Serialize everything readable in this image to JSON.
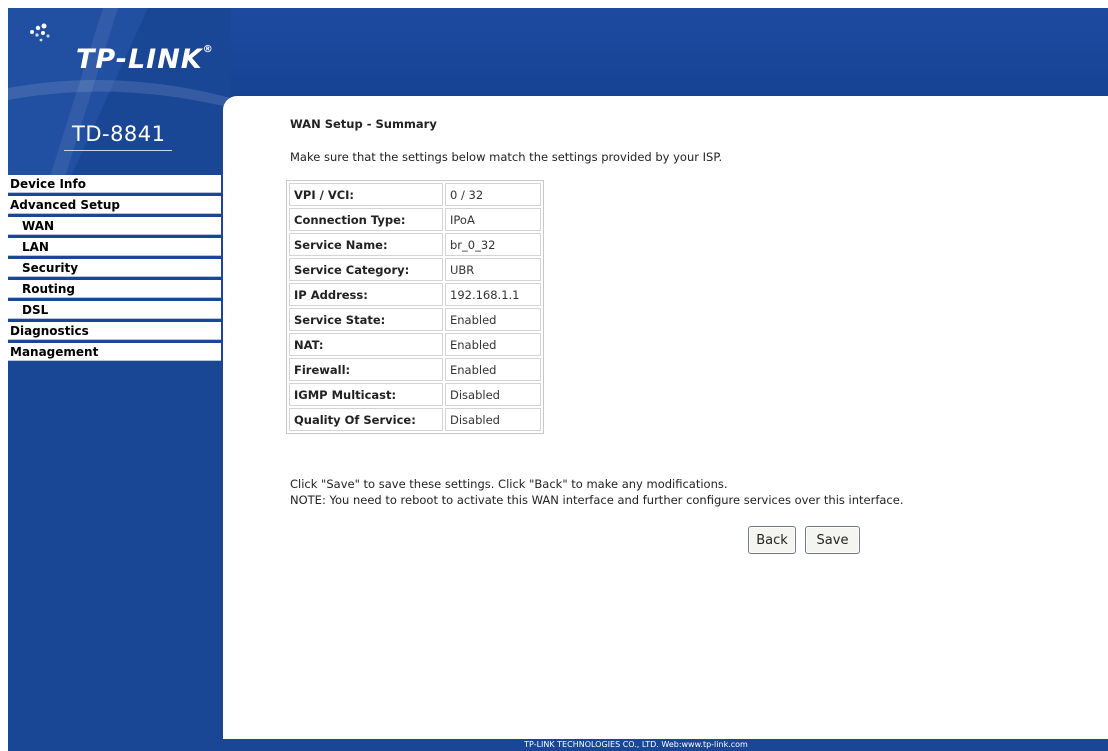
{
  "brand": {
    "logo_text": "TP-LINK",
    "trademark": "®",
    "model": "TD-8841"
  },
  "menu": [
    {
      "label": "Device Info",
      "level": 0
    },
    {
      "label": "Advanced Setup",
      "level": 0
    },
    {
      "label": "WAN",
      "level": 1
    },
    {
      "label": "LAN",
      "level": 1
    },
    {
      "label": "Security",
      "level": 1
    },
    {
      "label": "Routing",
      "level": 1
    },
    {
      "label": "DSL",
      "level": 1
    },
    {
      "label": "Diagnostics",
      "level": 0
    },
    {
      "label": "Management",
      "level": 0
    }
  ],
  "page": {
    "title": "WAN Setup - Summary",
    "intro": "Make sure that the settings below match the settings provided by your ISP.",
    "note1": "Click \"Save\" to save these settings. Click \"Back\" to make any modifications.",
    "note2": "NOTE: You need to reboot to activate this WAN interface and further configure services over this interface."
  },
  "summary": [
    {
      "key": "VPI / VCI:",
      "value": "0 / 32"
    },
    {
      "key": "Connection Type:",
      "value": "IPoA"
    },
    {
      "key": "Service Name:",
      "value": "br_0_32"
    },
    {
      "key": "Service Category:",
      "value": "UBR"
    },
    {
      "key": "IP Address:",
      "value": "192.168.1.1"
    },
    {
      "key": "Service State:",
      "value": "Enabled"
    },
    {
      "key": "NAT:",
      "value": "Enabled"
    },
    {
      "key": "Firewall:",
      "value": "Enabled"
    },
    {
      "key": "IGMP Multicast:",
      "value": "Disabled"
    },
    {
      "key": "Quality Of Service:",
      "value": "Disabled"
    }
  ],
  "buttons": {
    "back": "Back",
    "save": "Save"
  },
  "footer": "TP-LINK TECHNOLOGIES CO., LTD. Web:www.tp-link.com",
  "colors": {
    "brand_blue": "#1a4696",
    "menu_bg": "#ffffff"
  }
}
